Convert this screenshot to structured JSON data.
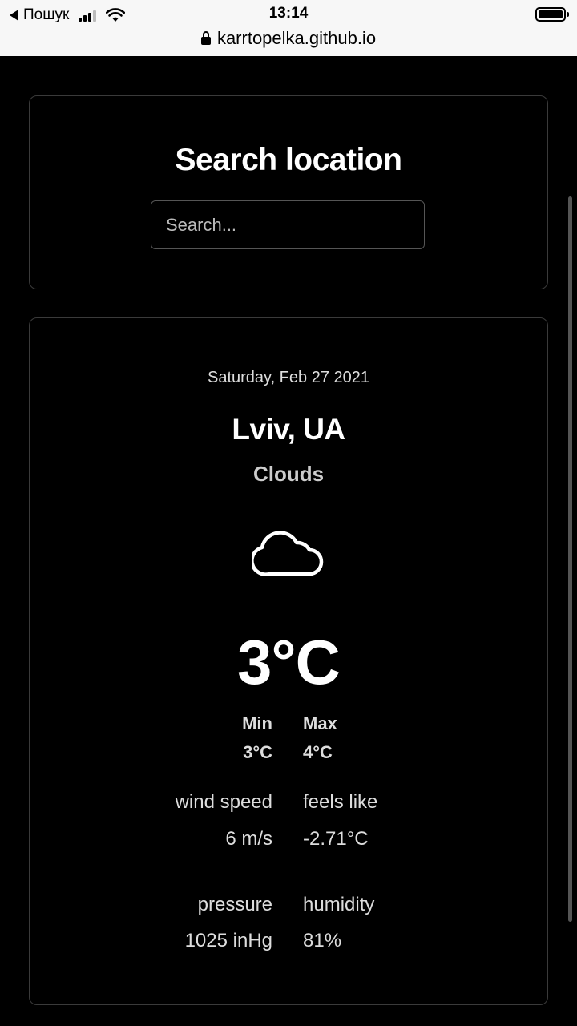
{
  "status_bar": {
    "carrier": "Пошук",
    "time": "13:14",
    "url": "karrtopelka.github.io"
  },
  "search": {
    "title": "Search location",
    "placeholder": "Search..."
  },
  "weather": {
    "date": "Saturday, Feb 27 2021",
    "location": "Lviv, UA",
    "condition": "Clouds",
    "condition_icon": "cloud-icon",
    "temperature": "3°C",
    "min_label": "Min",
    "min_value": "3°C",
    "max_label": "Max",
    "max_value": "4°C",
    "wind_label": "wind speed",
    "wind_value": "6 m/s",
    "feels_label": "feels like",
    "feels_value": "-2.71°C",
    "pressure_label": "pressure",
    "pressure_value": "1025 inHg",
    "humidity_label": "humidity",
    "humidity_value": "81%"
  }
}
